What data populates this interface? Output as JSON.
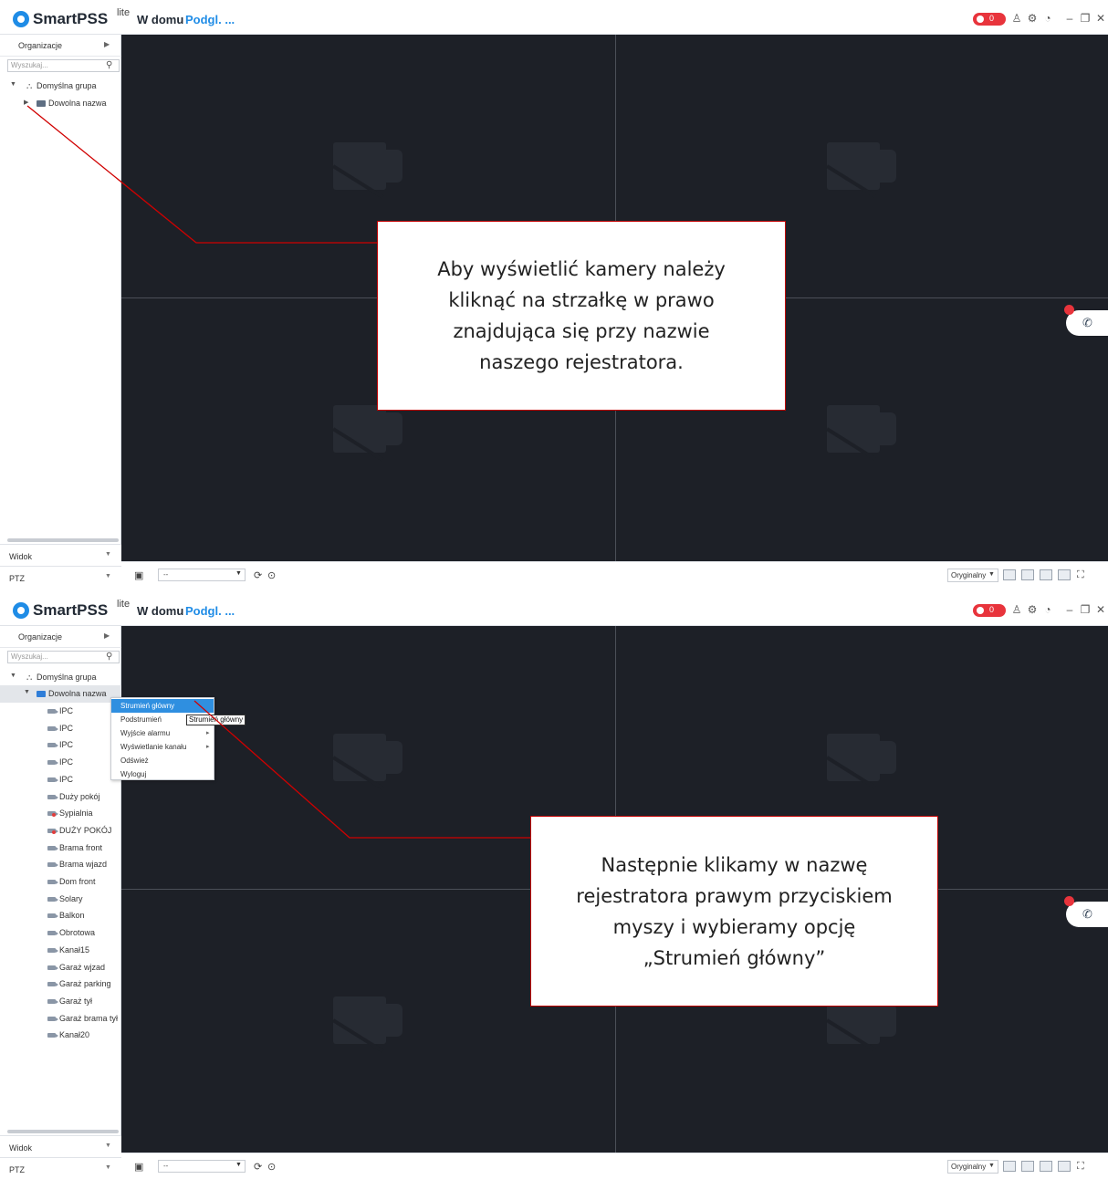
{
  "app": {
    "name": "SmartPSS",
    "name_sup": "lite",
    "tab_home": "W domu",
    "tab_live": "Podgl. ...",
    "alarm_count": "0"
  },
  "sidebar": {
    "organization_label": "Organizacje",
    "search_placeholder": "Wyszukaj...",
    "group_label": "Domyślna grupa",
    "device_label": "Dowolna nazwa",
    "view_label": "Widok",
    "ptz_label": "PTZ"
  },
  "channels": [
    "IPC",
    "IPC",
    "IPC",
    "IPC",
    "IPC",
    "Duży pokój",
    "Sypialnia",
    "DUŻY POKÓJ",
    "Brama front",
    "Brama wjazd",
    "Dom front",
    "Solary",
    "Balkon",
    "Obrotowa",
    "Kanał15",
    "Garaż wjzad",
    "Garaż parking",
    "Garaż tył",
    "Garaż brama tył",
    "Kanał20"
  ],
  "context_menu": {
    "items": [
      {
        "label": "Strumień główny"
      },
      {
        "label": "Podstrumień"
      },
      {
        "label": "Wyjście alarmu"
      },
      {
        "label": "Wyświetlanie kanału"
      },
      {
        "label": "Odśwież"
      },
      {
        "label": "Wyloguj"
      }
    ],
    "tooltip": "Strumień główny"
  },
  "bottombar": {
    "stream_value": "--",
    "scale_value": "Oryginalny"
  },
  "callouts": {
    "first": [
      "Aby wyświetlić kamery należy",
      "kliknąć na strzałkę w prawo",
      "znajdująca się przy nazwie",
      "naszego rejestratora."
    ],
    "second": [
      "Następnie klikamy w nazwę",
      "rejestratora prawym przyciskiem",
      "myszy i wybieramy opcję",
      "„Strumień główny”"
    ]
  },
  "colors": {
    "accent": "#1f8ce6",
    "alarm": "#e8343c",
    "callout_border": "#c00000",
    "video_bg": "#1d2027"
  }
}
